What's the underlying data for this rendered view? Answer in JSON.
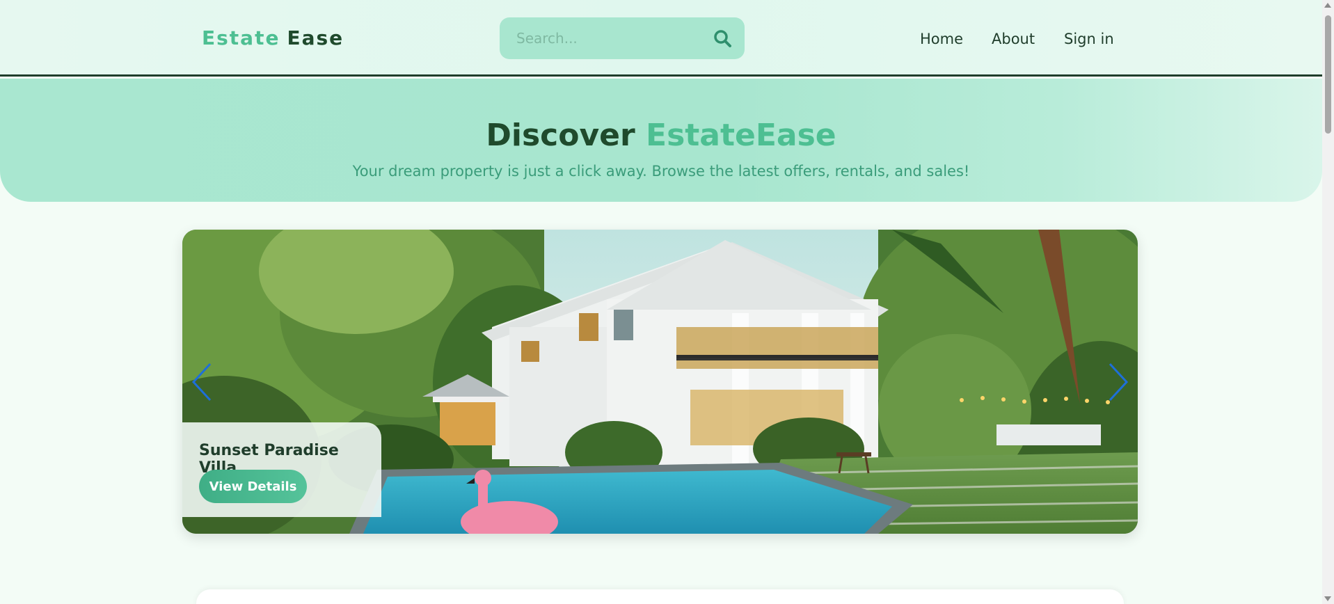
{
  "brand": {
    "part1": "Estate",
    "part2": "Ease"
  },
  "search": {
    "placeholder": "Search..."
  },
  "nav": {
    "home": "Home",
    "about": "About",
    "signin": "Sign in"
  },
  "hero": {
    "title_prefix": "Discover",
    "title_accent": "EstateEase",
    "subtitle": "Your dream property is just a click away. Browse the latest offers, rentals, and sales!"
  },
  "carousel": {
    "slide_title": "Sunset Paradise Villa",
    "button_label": "View Details"
  },
  "icons": {
    "search": "search-icon",
    "prev": "chevron-left-icon",
    "next": "chevron-right-icon"
  },
  "colors": {
    "accent": "#4dbf92",
    "dark_green": "#1f4a2c",
    "hero_bg": "#a8e6cf",
    "arrow": "#1e6fd9"
  }
}
